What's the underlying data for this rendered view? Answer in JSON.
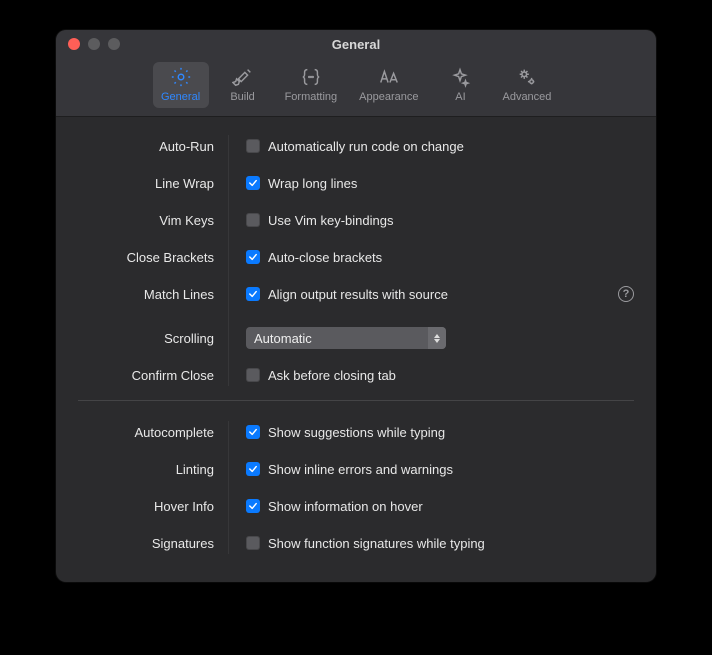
{
  "window": {
    "title": "General"
  },
  "tabs": [
    {
      "id": "general",
      "label": "General",
      "selected": true
    },
    {
      "id": "build",
      "label": "Build",
      "selected": false
    },
    {
      "id": "formatting",
      "label": "Formatting",
      "selected": false
    },
    {
      "id": "appearance",
      "label": "Appearance",
      "selected": false
    },
    {
      "id": "ai",
      "label": "AI",
      "selected": false
    },
    {
      "id": "advanced",
      "label": "Advanced",
      "selected": false
    }
  ],
  "settings": {
    "autorun": {
      "label": "Auto-Run",
      "text": "Automatically run code on change",
      "checked": false
    },
    "linewrap": {
      "label": "Line Wrap",
      "text": "Wrap long lines",
      "checked": true
    },
    "vimkeys": {
      "label": "Vim Keys",
      "text": "Use Vim key-bindings",
      "checked": false
    },
    "closebrackets": {
      "label": "Close Brackets",
      "text": "Auto-close brackets",
      "checked": true
    },
    "matchlines": {
      "label": "Match Lines",
      "text": "Align output results with source",
      "checked": true,
      "help": true
    },
    "scrolling": {
      "label": "Scrolling",
      "value": "Automatic"
    },
    "confirmclose": {
      "label": "Confirm Close",
      "text": "Ask before closing tab",
      "checked": false
    },
    "autocomplete": {
      "label": "Autocomplete",
      "text": "Show suggestions while typing",
      "checked": true
    },
    "linting": {
      "label": "Linting",
      "text": "Show inline errors and warnings",
      "checked": true
    },
    "hoverinfo": {
      "label": "Hover Info",
      "text": "Show information on hover",
      "checked": true
    },
    "signatures": {
      "label": "Signatures",
      "text": "Show function signatures while typing",
      "checked": false
    }
  }
}
